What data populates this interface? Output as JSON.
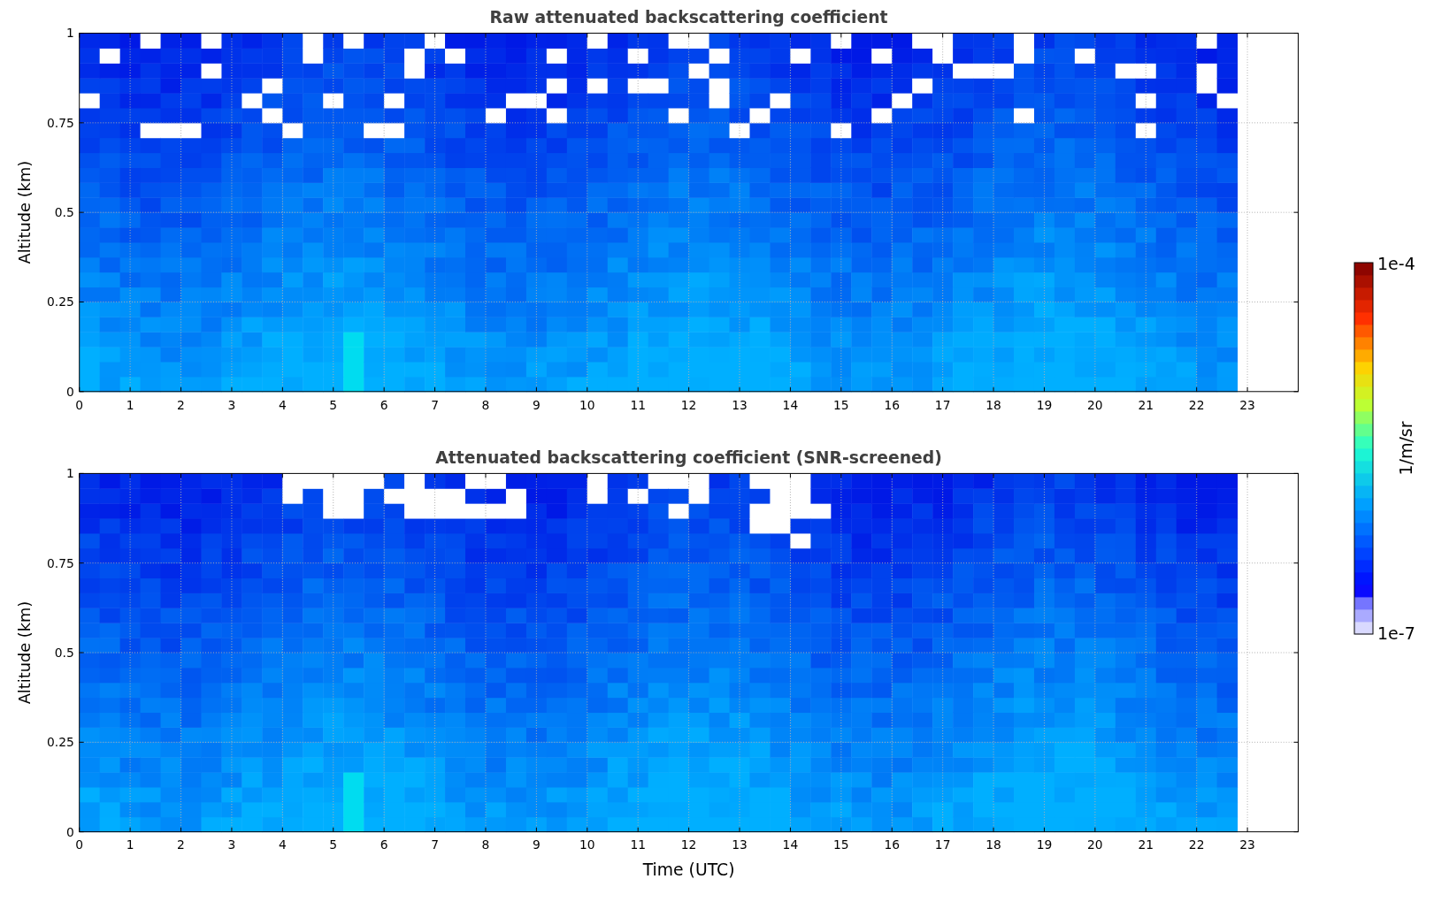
{
  "figure": {
    "panels": [
      {
        "title": "Raw attenuated backscattering coefficient",
        "ylabel": "Altitude (km)",
        "yticks": [
          "1",
          "0.75",
          "0.5",
          "0.25",
          "0"
        ],
        "xticks": [
          "0",
          "1",
          "2",
          "3",
          "4",
          "5",
          "6",
          "7",
          "8",
          "9",
          "10",
          "11",
          "12",
          "13",
          "14",
          "15",
          "16",
          "17",
          "18",
          "19",
          "20",
          "21",
          "22",
          "23"
        ],
        "screened": false
      },
      {
        "title": "Attenuated backscattering coefficient (SNR-screened)",
        "ylabel": "Altitude (km)",
        "yticks": [
          "1",
          "0.75",
          "0.5",
          "0.25",
          "0"
        ],
        "xticks": [
          "0",
          "1",
          "2",
          "3",
          "4",
          "5",
          "6",
          "7",
          "8",
          "9",
          "10",
          "11",
          "12",
          "13",
          "14",
          "15",
          "16",
          "17",
          "18",
          "19",
          "20",
          "21",
          "22",
          "23"
        ],
        "xlabel": "Time (UTC)",
        "screened": true
      }
    ],
    "colorbar": {
      "label": "1/m/sr",
      "max_label": "1e-4",
      "min_label": "1e-7"
    }
  }
}
